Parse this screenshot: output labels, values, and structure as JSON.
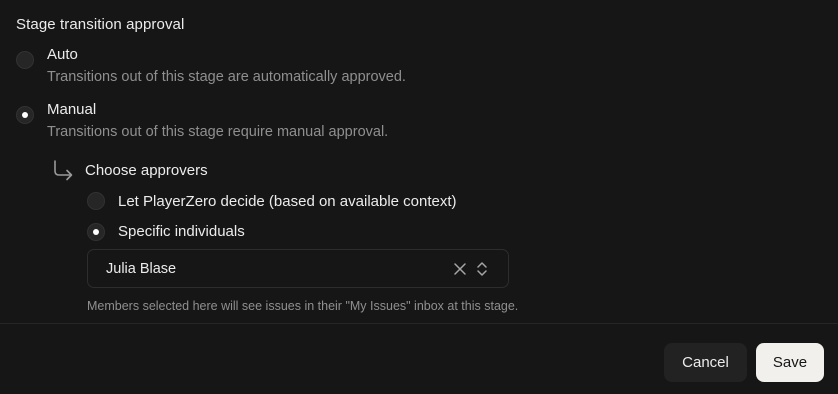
{
  "stage_approval": {
    "title": "Stage transition approval",
    "options": [
      {
        "label": "Auto",
        "description": "Transitions out of this stage are automatically approved.",
        "selected": false
      },
      {
        "label": "Manual",
        "description": "Transitions out of this stage require manual approval.",
        "selected": true
      }
    ]
  },
  "approvers": {
    "title": "Choose approvers",
    "options": [
      {
        "label": "Let PlayerZero decide (based on available context)",
        "selected": false
      },
      {
        "label": "Specific individuals",
        "selected": true
      }
    ],
    "select": {
      "value": "Julia Blase"
    },
    "helper": "Members selected here will see issues in their \"My Issues\" inbox at this stage."
  },
  "footer": {
    "cancel_label": "Cancel",
    "save_label": "Save"
  },
  "colors": {
    "background": "#161616",
    "save_bg": "#f1f0ec",
    "cancel_bg": "#222222",
    "muted_text": "#8f8f8f"
  },
  "icons": [
    "return-arrow-icon",
    "clear-icon",
    "chevron-up-down-icon"
  ]
}
